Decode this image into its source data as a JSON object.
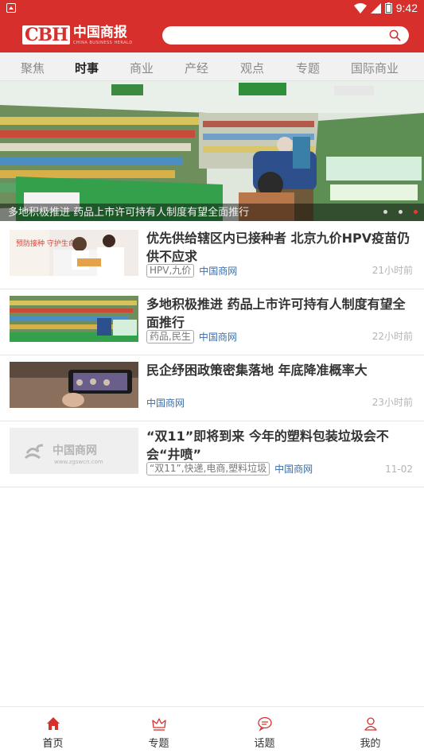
{
  "status_bar": {
    "time": "9:42"
  },
  "header": {
    "logo_mark": "CBH",
    "logo_name": "中国商报",
    "logo_sub": "CHINA BUSINESS HERALD",
    "search_placeholder": ""
  },
  "tabs": [
    {
      "label": "聚焦",
      "active": false
    },
    {
      "label": "时事",
      "active": true
    },
    {
      "label": "商业",
      "active": false
    },
    {
      "label": "产经",
      "active": false
    },
    {
      "label": "观点",
      "active": false
    },
    {
      "label": "专题",
      "active": false
    },
    {
      "label": "国际商业",
      "active": false
    }
  ],
  "banner": {
    "caption": "多地积极推进 药品上市许可持有人制度有望全面推行",
    "slide_count": 3,
    "active_slide": 3
  },
  "news": [
    {
      "title": "优先供给辖区内已接种者 北京九价HPV疫苗仍供不应求",
      "tag": "HPV,九价",
      "source": "中国商网",
      "time": "21小时前",
      "thumb_text": "预防接种 守护生命"
    },
    {
      "title": "多地积极推进 药品上市许可持有人制度有望全面推行",
      "tag": "药品,民生",
      "source": "中国商网",
      "time": "22小时前"
    },
    {
      "title": "民企纾困政策密集落地 年底降准概率大",
      "tag": "",
      "source": "中国商网",
      "time": "23小时前"
    },
    {
      "title": "“双11”即将到来 今年的塑料包装垃圾会不会“井喷”",
      "tag": "“双11”,快递,电商,塑料垃圾",
      "source": "中国商网",
      "time": "11-02",
      "thumb_text": "中国商网",
      "thumb_sub": "www.zgswcn.com"
    }
  ],
  "bottom_nav": [
    {
      "label": "首页",
      "icon": "home-icon",
      "active": true
    },
    {
      "label": "专题",
      "icon": "crown-icon",
      "active": false
    },
    {
      "label": "话题",
      "icon": "chat-icon",
      "active": false
    },
    {
      "label": "我的",
      "icon": "user-icon",
      "active": false
    }
  ],
  "colors": {
    "brand": "#d7302c",
    "link": "#3a6ea8",
    "active_dot": "#e23b35"
  }
}
